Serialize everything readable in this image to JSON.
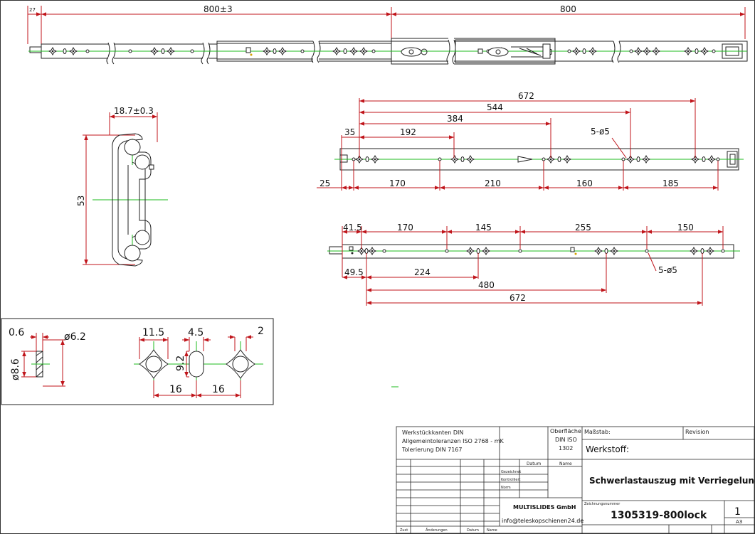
{
  "views": {
    "top": {
      "dim_left_small": "27",
      "dim_left": "800±3",
      "dim_right": "800"
    },
    "profile": {
      "width": "18.7±0.3",
      "height": "53"
    },
    "outer_rail": {
      "top_dims": [
        "672",
        "544",
        "384",
        "192",
        "35"
      ],
      "callout": "5-ø5",
      "bottom_dims": [
        "25",
        "170",
        "210",
        "160",
        "185"
      ]
    },
    "inner_rail": {
      "top_dims": [
        "41.5",
        "170",
        "145",
        "255",
        "150"
      ],
      "callout": "5-ø5",
      "bottom_dims": [
        "49.5",
        "224",
        "480",
        "672"
      ]
    },
    "detail": {
      "dims": [
        "0.6",
        "ø6.2",
        "ø8.6",
        "11.5",
        "4.5",
        "2",
        "9.2",
        "16",
        "16"
      ]
    }
  },
  "title_block": {
    "general_notes": [
      "Werkstückkanten DIN",
      "Allgemeintoleranzen ISO 2768 - mK",
      "Tolerierung DIN 7167"
    ],
    "surface_label": "Oberfläche",
    "surface_value_1": "DIN ISO",
    "surface_value_2": "1302",
    "scale_label": "Maßstab:",
    "revision_label": "Revision",
    "material_label": "Werkstoff:",
    "datum_label": "Datum",
    "name_label": "Name",
    "row_labels": [
      "Gezeichnet",
      "Kontrolliert",
      "Norm"
    ],
    "company": "MULTISLIDES GmbH",
    "email": "info@teleskopschienen24.de",
    "title": "Schwerlastauszug mit Verriegelung",
    "drawing_no_label": "Zeichnungsnummer",
    "drawing_no": "1305319-800lock",
    "sheet_no": "1",
    "sheet_format": "A3",
    "footer": [
      "Zust",
      "Änderungen",
      "Datum",
      "Name"
    ]
  }
}
